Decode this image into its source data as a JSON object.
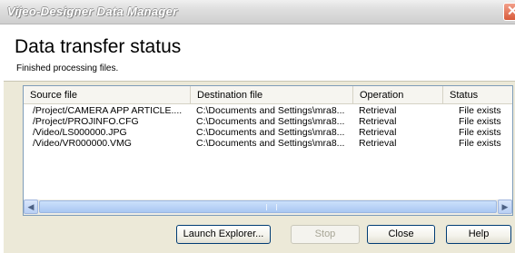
{
  "window": {
    "title": "Vijeo-Designer Data Manager"
  },
  "header": {
    "heading": "Data transfer status",
    "subtext": "Finished processing files."
  },
  "table": {
    "columns": [
      "Source file",
      "Destination file",
      "Operation",
      "Status"
    ],
    "rows": [
      [
        "/Project/CAMERA APP ARTICLE....",
        "C:\\Documents and Settings\\mra8...",
        "Retrieval",
        "File exists"
      ],
      [
        "/Project/PROJINFO.CFG",
        "C:\\Documents and Settings\\mra8...",
        "Retrieval",
        "File exists"
      ],
      [
        "/Video/LS000000.JPG",
        "C:\\Documents and Settings\\mra8...",
        "Retrieval",
        "File exists"
      ],
      [
        "/Video/VR000000.VMG",
        "C:\\Documents and Settings\\mra8...",
        "Retrieval",
        "File exists"
      ]
    ]
  },
  "buttons": {
    "launch_explorer": "Launch Explorer...",
    "stop": "Stop",
    "close": "Close",
    "help": "Help"
  },
  "icons": {
    "close": "close-icon",
    "scroll_left": "chevron-left-icon",
    "scroll_right": "chevron-right-icon"
  }
}
